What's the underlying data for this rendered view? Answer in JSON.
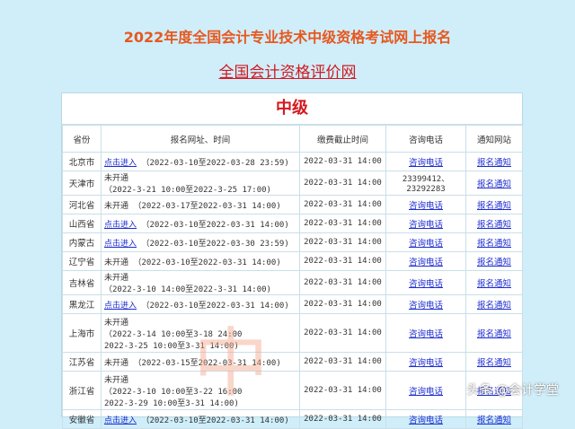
{
  "headline": "2022年度全国会计专业技术中级资格考试网上报名",
  "sublink": "全国会计资格评价网",
  "panel_title": "中级",
  "columns": [
    "省份",
    "报名网址、时间",
    "缴费截止时间",
    "咨询电话",
    "通知网站"
  ],
  "rows": [
    {
      "province": "北京市",
      "status": "点击进入",
      "time1": "（2022-03-10至2022-03-28 23:59)",
      "fee": "2022-03-31 14:00",
      "phone": "咨询电话",
      "notice": "报名通知"
    },
    {
      "province": "天津市",
      "status": "未开通",
      "time1": "（2022-3-21 10:00至2022-3-25 17:00)",
      "fee": "2022-03-31 14:00",
      "phone": "23399412、23292283",
      "notice": "报名通知"
    },
    {
      "province": "河北省",
      "status": "未开通",
      "time1": "（2022-03-17至2022-03-31 14:00)",
      "fee": "2022-03-31 14:00",
      "phone": "咨询电话",
      "notice": "报名通知"
    },
    {
      "province": "山西省",
      "status": "点击进入",
      "time1": "（2022-03-10至2022-03-31 14:00)",
      "fee": "2022-03-31 14:00",
      "phone": "咨询电话",
      "notice": "报名通知"
    },
    {
      "province": "内蒙古",
      "status": "点击进入",
      "time1": "（2022-03-10至2022-03-30 23:59)",
      "fee": "2022-03-31 14:00",
      "phone": "咨询电话",
      "notice": "报名通知"
    },
    {
      "province": "辽宁省",
      "status": "未开通",
      "time1": "（2022-03-10至2022-03-31 14:00)",
      "fee": "2022-03-31 14:00",
      "phone": "咨询电话",
      "notice": "报名通知"
    },
    {
      "province": "吉林省",
      "status": "未开通",
      "time1": "（2022-3-10 14:00至2022-3-31 14:00)",
      "fee": "2022-03-31 14:00",
      "phone": "咨询电话",
      "notice": "报名通知"
    },
    {
      "province": "黑龙江",
      "status": "点击进入",
      "time1": "（2022-03-10至2022-03-31 14:00)",
      "fee": "2022-03-31 14:00",
      "phone": "咨询电话",
      "notice": "报名通知"
    },
    {
      "province": "上海市",
      "status": "未开通",
      "time1": "（2022-3-14 10:00至3-18 24:00",
      "time2": "2022-3-25 10:00至3-31 14:00)",
      "fee": "2022-03-31 14:00",
      "phone": "咨询电话",
      "notice": "报名通知"
    },
    {
      "province": "江苏省",
      "status": "未开通",
      "time1": "（2022-03-15至2022-03-31 14:00)",
      "fee": "2022-03-31 14:00",
      "phone": "咨询电话",
      "notice": "报名通知"
    },
    {
      "province": "浙江省",
      "status": "未开通",
      "time1": "（2022-3-10 10:00至3-22 16:00",
      "time2": "2022-3-29 10:00至3-31 14:00)",
      "fee": "2022-03-31 14:00",
      "phone": "咨询电话",
      "notice": "报名通知"
    },
    {
      "province": "安徽省",
      "status": "点击进入",
      "time1": "（2022-03-10至2022-03-31 14:00)",
      "fee": "2022-03-31 14:00",
      "phone": "咨询电话",
      "notice": "报名通知"
    }
  ],
  "watermark_text": "中",
  "credit": "头条 @会计学堂",
  "colors": {
    "headline": "#e8571e",
    "accent_red": "#d2191f",
    "link_blue": "#1d2cd0",
    "background": "#cfeefa"
  }
}
